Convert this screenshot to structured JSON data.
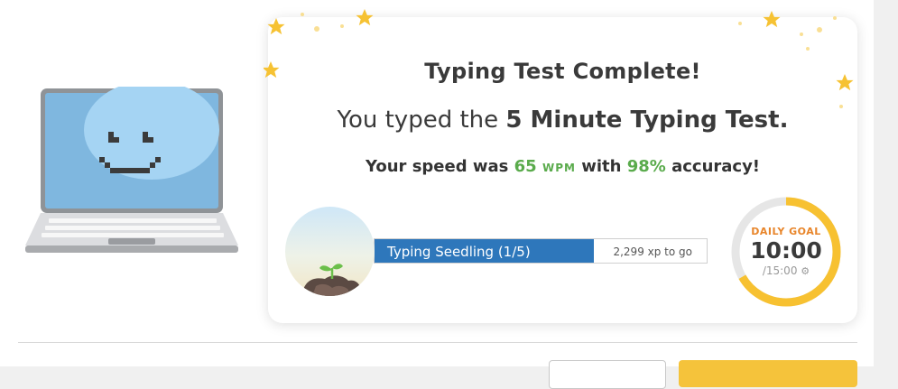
{
  "result": {
    "title": "Typing Test Complete!",
    "subtitle_prefix": "You typed the ",
    "test_name": "5 Minute Typing Test.",
    "speed_prefix": "Your speed was ",
    "wpm": "65",
    "wpm_unit": "WPM",
    "speed_middle": " with ",
    "accuracy": "98%",
    "speed_suffix": " accuracy!"
  },
  "progress": {
    "rank_label": "Typing Seedling (1/5)",
    "xp_to_go": "2,299 xp to go",
    "fill_fraction": 0.66
  },
  "daily_goal": {
    "label": "DAILY GOAL",
    "time": "10:00",
    "total": "/15:00",
    "progress_fraction": 0.6667,
    "settings_icon": "gear-icon"
  },
  "colors": {
    "accent_green": "#5aab4c",
    "progress_blue": "#2e77bb",
    "goal_ring": "#f7c131",
    "goal_label": "#e8852a"
  }
}
